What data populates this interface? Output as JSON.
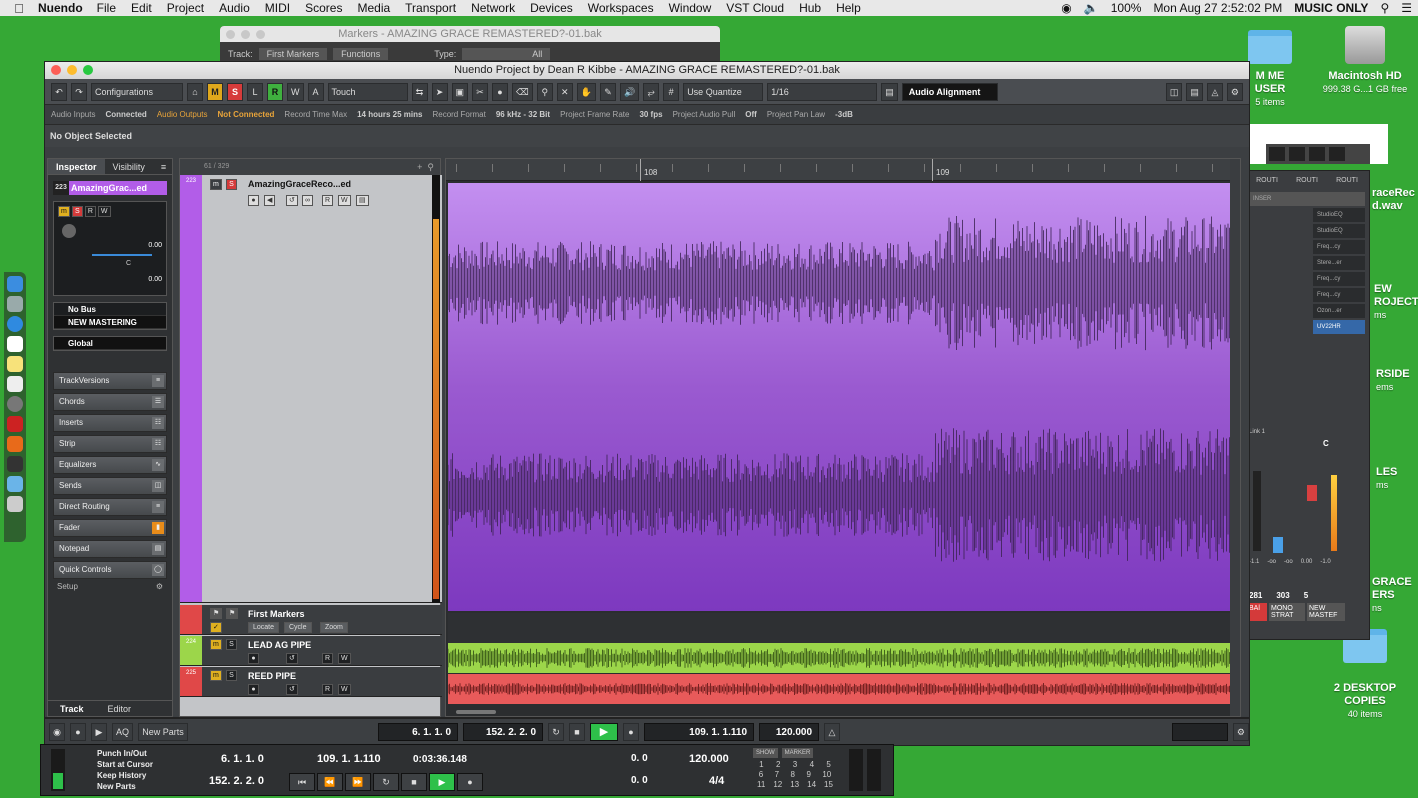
{
  "menubar": {
    "app": "Nuendo",
    "items": [
      "File",
      "Edit",
      "Project",
      "Audio",
      "MIDI",
      "Scores",
      "Media",
      "Transport",
      "Network",
      "Devices",
      "Workspaces",
      "Window",
      "VST Cloud",
      "Hub",
      "Help"
    ],
    "battery": "100%",
    "clock": "Mon Aug 27  2:52:02 PM",
    "user": "MUSIC ONLY"
  },
  "desktop": {
    "icons": [
      {
        "label": "M ME USER",
        "sub": "5 items"
      },
      {
        "label": "Macintosh HD",
        "sub": "999.38 G...1 GB free"
      },
      {
        "label": "raceRec\nd.wav",
        "sub": ""
      },
      {
        "label": "EW\nROJECT",
        "sub": "ms"
      },
      {
        "label": "RSIDE",
        "sub": "ems"
      },
      {
        "label": "LES",
        "sub": "ms"
      },
      {
        "label": "GRACE\nERS",
        "sub": "ns"
      },
      {
        "label": "2 DESKTOP\nCOPIES",
        "sub": "40 items"
      }
    ]
  },
  "markers_window": {
    "title": "Markers - AMAZING GRACE REMASTERED?-01.bak",
    "track_label": "Track:",
    "track_value": "First Markers",
    "functions": "Functions",
    "type_label": "Type:",
    "type_value": "All"
  },
  "window": {
    "title": "Nuendo Project by Dean R Kibbe - AMAZING GRACE REMASTERED?-01.bak"
  },
  "toolbar": {
    "configurations": "Configurations",
    "m": "M",
    "s": "S",
    "l": "L",
    "r": "R",
    "w": "W",
    "a": "A",
    "automation_mode": "Touch",
    "quantize_mode": "Use Quantize",
    "quantize_value": "1/16",
    "audio_alignment": "Audio Alignment"
  },
  "statusbar": {
    "audio_inputs": "Audio Inputs",
    "inputs_value": "Connected",
    "audio_outputs": "Audio Outputs",
    "outputs_value": "Not Connected",
    "record_time_max": "Record Time Max",
    "record_time_value": "14 hours 25 mins",
    "record_format": "Record Format",
    "record_format_value": "96 kHz - 32 Bit",
    "frame_rate": "Project Frame Rate",
    "frame_rate_value": "30 fps",
    "audio_pull": "Project Audio Pull",
    "audio_pull_value": "Off",
    "pan_law": "Project Pan Law",
    "pan_law_value": "-3dB"
  },
  "infoline": "No Object Selected",
  "inspector": {
    "tab_inspector": "Inspector",
    "tab_visibility": "Visibility",
    "track_number": "223",
    "track_name": "AmazingGrac...ed",
    "volume": "0.00",
    "pan_center": "C",
    "pan": "0.00",
    "input": "No Bus",
    "output": "NEW MASTERING",
    "group": "Global",
    "sections": [
      "TrackVersions",
      "Chords",
      "Inserts",
      "Strip",
      "Equalizers",
      "Sends",
      "Direct Routing",
      "Fader",
      "Notepad",
      "Quick Controls"
    ],
    "setup": "Setup",
    "bottom_track": "Track",
    "bottom_editor": "Editor"
  },
  "tracklist": {
    "counter": "61 / 329",
    "tracks": [
      {
        "num": "223",
        "name": "AmazingGraceReco...ed"
      },
      {
        "num": "",
        "name": "First Markers",
        "buttons": [
          "Locate",
          "Cycle",
          "Zoom"
        ]
      },
      {
        "num": "224",
        "name": "LEAD AG PIPE"
      },
      {
        "num": "225",
        "name": "REED PIPE"
      }
    ]
  },
  "ruler": {
    "bar1": "108",
    "bar2": "109"
  },
  "colors": {
    "audio_track": "#b25de8",
    "lead_pipe": "#9cd64a",
    "reed_pipe": "#e04848",
    "markers": "#e04848"
  },
  "transport": {
    "left_locator": "6. 1. 1.  0",
    "right_locator": "152. 2. 2.  0",
    "position": "109. 1. 1.110",
    "tempo": "120.000",
    "tempo2": "120.000",
    "new_parts": "New Parts",
    "aq": "AQ"
  },
  "bigtransport": {
    "punch": "Punch In/Out",
    "start_at_cursor": "Start at Cursor",
    "keep_history": "Keep History",
    "new_parts": "New Parts",
    "left": "6. 1. 1.  0",
    "right": "152. 2. 2.  0",
    "position": "109. 1. 1.110",
    "time": "0:03:36.148",
    "zero1": "0.  0",
    "zero2": "0.  0",
    "tempo": "120.000",
    "signature": "4/4",
    "show": "SHOW",
    "marker": "MARKER",
    "markers": [
      "1",
      "2",
      "3",
      "4",
      "5",
      "6",
      "7",
      "8",
      "9",
      "10",
      "11",
      "12",
      "13",
      "14",
      "15"
    ]
  },
  "mixer": {
    "headers": [
      "ROUTI",
      "ROUTI",
      "ROUTI"
    ],
    "inserts_label": "INSER",
    "slots": [
      "StudioEQ",
      "StudioEQ",
      "Freq...cy",
      "Stere...er",
      "Freq...cy",
      "Freq...cy",
      "Ozon...er",
      "UV22HR"
    ],
    "link": "Link 1",
    "c": "C",
    "vals": [
      "-1.1",
      "-oo",
      "-oo",
      "0.00",
      "-1.0"
    ],
    "nums": [
      "281",
      "303",
      "5"
    ],
    "names": [
      "BAl",
      "MONO STRAT",
      "NEW MASTEF"
    ]
  }
}
